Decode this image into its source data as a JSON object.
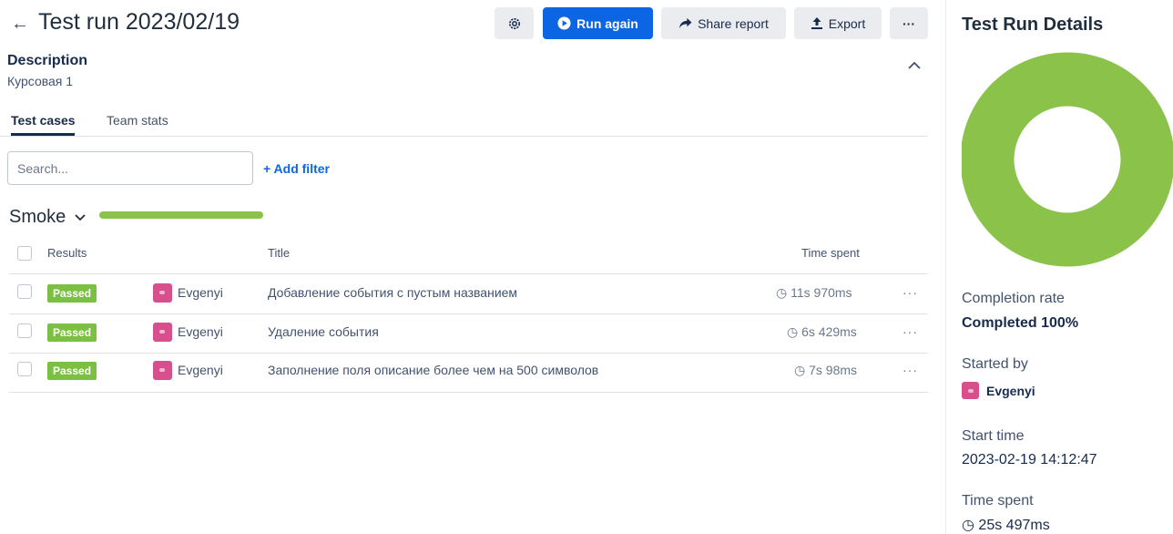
{
  "header": {
    "back_glyph": "←",
    "title": "Test run 2023/02/19",
    "run_again_label": "Run again",
    "share_label": "Share report",
    "export_label": "Export",
    "more_label": "···"
  },
  "description": {
    "label": "Description",
    "text": "Курсовая 1"
  },
  "tabs": [
    {
      "label": "Test cases",
      "active": true
    },
    {
      "label": "Team stats",
      "active": false
    }
  ],
  "search": {
    "placeholder": "Search..."
  },
  "add_filter_label": "+ Add filter",
  "suite": {
    "name": "Smoke",
    "progress": 1.0,
    "progress_color": "#8bc34a"
  },
  "table": {
    "headers": {
      "results": "Results",
      "title": "Title",
      "time": "Time spent"
    },
    "rows": [
      {
        "status": "Passed",
        "assignee": "Evgenyi",
        "title": "Добавление события с пустым названием",
        "time": "11s 970ms"
      },
      {
        "status": "Passed",
        "assignee": "Evgenyi",
        "title": "Удаление события",
        "time": "6s 429ms"
      },
      {
        "status": "Passed",
        "assignee": "Evgenyi",
        "title": "Заполнение поля описание более чем на 500 символов",
        "time": "7s 98ms"
      }
    ]
  },
  "details": {
    "title": "Test Run Details",
    "completion_label": "Completion rate",
    "completion_value": "Completed 100%",
    "completion_fraction": 1.0,
    "donut_color": "#8bc34a",
    "started_by_label": "Started by",
    "started_by_value": "Evgenyi",
    "start_time_label": "Start time",
    "start_time_value": "2023-02-19 14:12:47",
    "time_spent_label": "Time spent",
    "time_spent_value": "25s 497ms"
  },
  "colors": {
    "primary": "#0c66e4",
    "passed": "#7bc043",
    "avatar": "#d74f8c"
  }
}
